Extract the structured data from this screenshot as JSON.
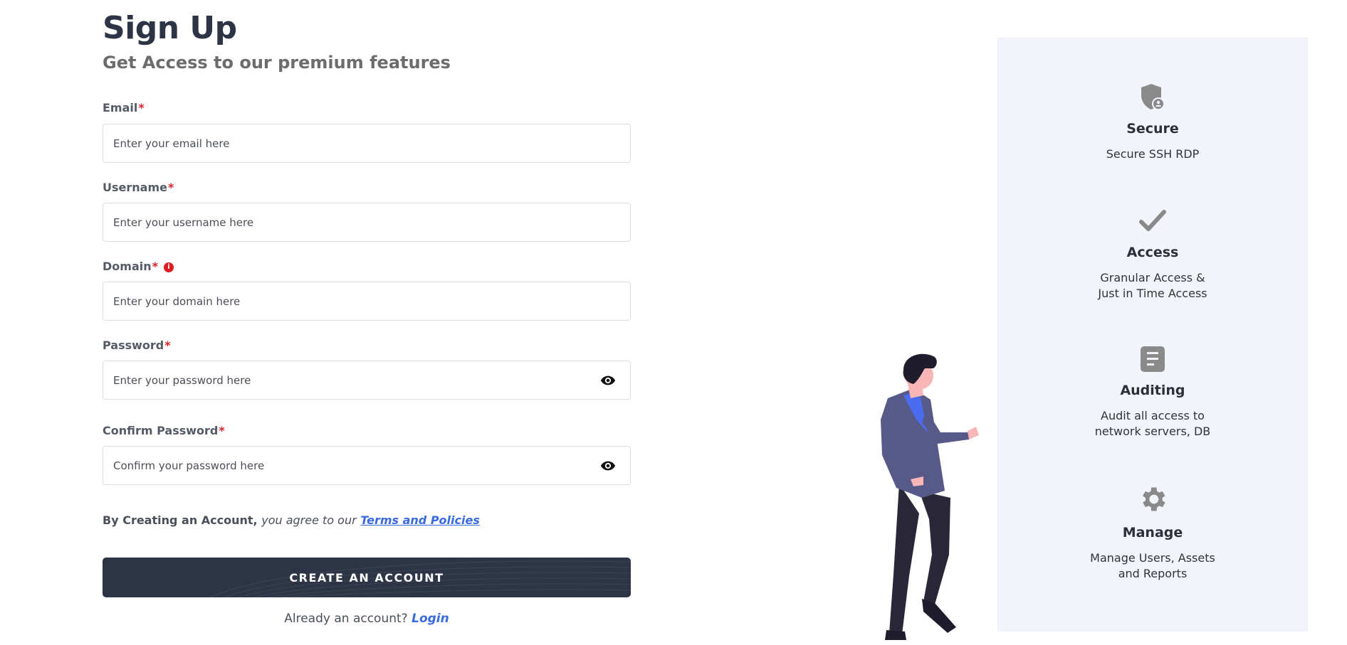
{
  "header": {
    "title": "Sign Up",
    "subtitle": "Get Access to our premium features"
  },
  "form": {
    "required_mark": "*",
    "fields": {
      "email": {
        "label": "Email",
        "placeholder": "Enter your email here",
        "value": ""
      },
      "username": {
        "label": "Username",
        "placeholder": "Enter your username here",
        "value": ""
      },
      "domain": {
        "label": "Domain",
        "placeholder": "Enter your domain here",
        "value": "",
        "info_icon": "info-icon"
      },
      "password": {
        "label": "Password",
        "placeholder": "Enter your password here",
        "value": "",
        "toggle_icon": "eye-icon"
      },
      "confirm_password": {
        "label": "Confirm Password",
        "placeholder": "Confirm your password here",
        "value": "",
        "toggle_icon": "eye-icon"
      }
    },
    "terms": {
      "prefix": "By Creating an Account,",
      "middle": "you agree to our",
      "link": "Terms and Policies"
    },
    "submit_label": "CREATE AN ACCOUNT",
    "login_prompt": "Already an account?",
    "login_link": "Login"
  },
  "features": [
    {
      "icon": "shield-user-icon",
      "title": "Secure",
      "description": "Secure SSH RDP"
    },
    {
      "icon": "checkmark-icon",
      "title": "Access",
      "description": "Granular Access &\nJust in Time Access"
    },
    {
      "icon": "document-icon",
      "title": "Auditing",
      "description": "Audit all access to\nnetwork servers, DB"
    },
    {
      "icon": "gear-icon",
      "title": "Manage",
      "description": "Manage Users, Assets\nand Reports"
    }
  ],
  "colors": {
    "primary": "#2d3446",
    "required": "#d9242b",
    "link": "#3a6ae0",
    "panel_bg": "#f1f4fb"
  }
}
